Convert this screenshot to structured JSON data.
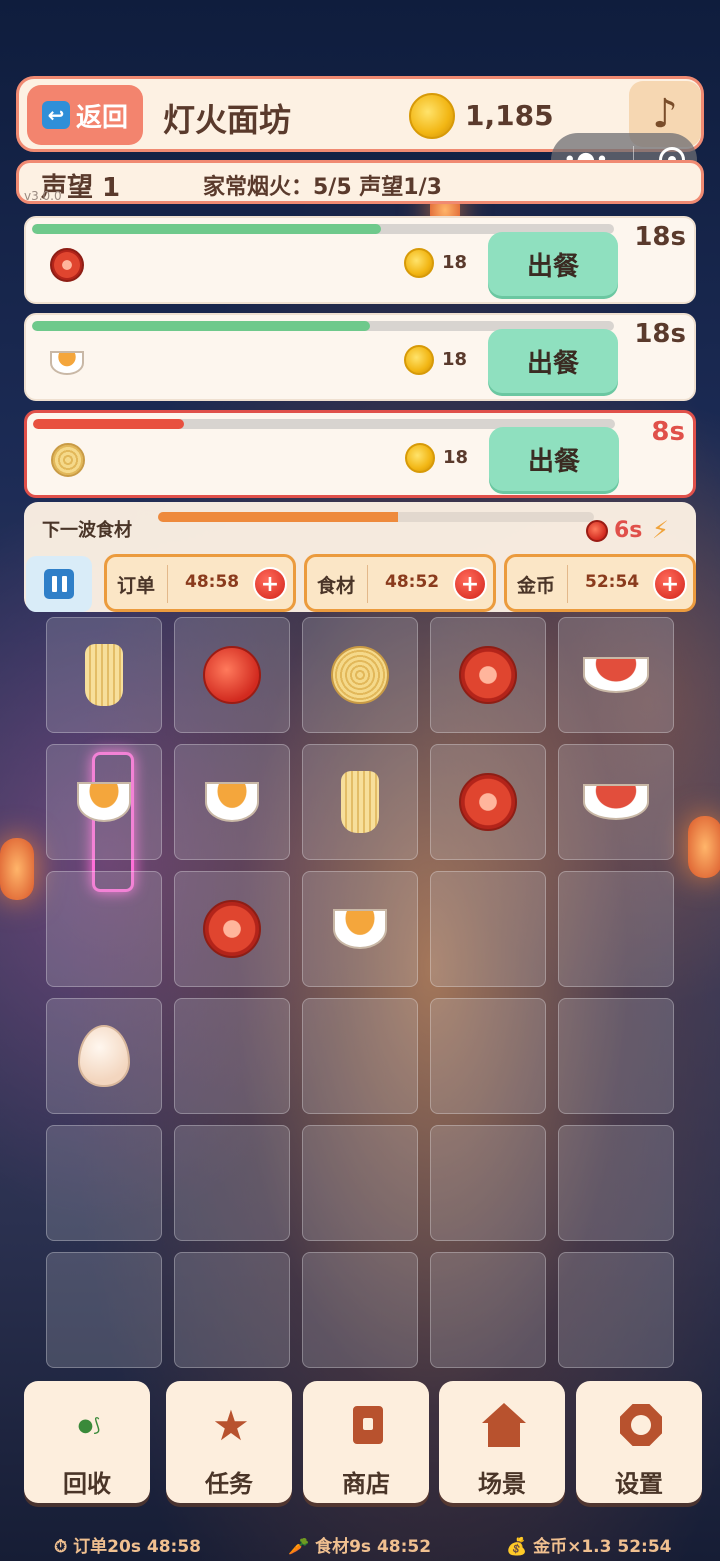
{
  "header": {
    "back_label": "返回",
    "back_icon": "↩",
    "shop_name": "灯火面坊",
    "coins": "1,185",
    "music_icon": "♪"
  },
  "reputation": {
    "level": "声望 1",
    "description": "家常烟火：5/5 声望1/3"
  },
  "version": "v3.0.0",
  "orders": [
    {
      "food": "tomato-slice",
      "progress": 0.6,
      "reward": "18",
      "serve_label": "出餐",
      "time": "18s",
      "urgent": false
    },
    {
      "food": "soup",
      "progress": 0.58,
      "reward": "18",
      "serve_label": "出餐",
      "time": "18s",
      "urgent": false
    },
    {
      "food": "noodles",
      "progress": 0.26,
      "reward": "18",
      "serve_label": "出餐",
      "time": "8s",
      "urgent": true
    }
  ],
  "wave": {
    "label": "下一波食材",
    "progress": 0.55,
    "time": "6s",
    "bolt": "⚡"
  },
  "boosts": [
    {
      "label": "订单",
      "time": "48:58",
      "plus": "+"
    },
    {
      "label": "食材",
      "time": "48:52",
      "plus": "+"
    },
    {
      "label": "金币",
      "time": "52:54",
      "plus": "+"
    }
  ],
  "board": [
    [
      "noodle-strands",
      "tomato",
      "noodles",
      "tomato-slice",
      "meat-bowl"
    ],
    [
      "soup",
      "soup",
      "noodle-strands",
      "tomato-slice",
      "meat-bowl"
    ],
    [
      "",
      "tomato-slice",
      "soup",
      "",
      ""
    ],
    [
      "egg",
      "",
      "",
      "",
      ""
    ],
    [
      "",
      "",
      "",
      "",
      ""
    ],
    [
      "",
      "",
      "",
      "",
      ""
    ]
  ],
  "nav": [
    {
      "label": "回收",
      "icon": "recycle-icon"
    },
    {
      "label": "任务",
      "icon": "star-icon"
    },
    {
      "label": "商店",
      "icon": "shop-icon"
    },
    {
      "label": "场景",
      "icon": "house-icon"
    },
    {
      "label": "设置",
      "icon": "gear-icon"
    }
  ],
  "status": {
    "orders": "⏱ 订单20s 48:58",
    "ingredients": "🥕 食材9s 48:52",
    "coins": "💰 金币×1.3 52:54"
  },
  "colors": {
    "accent": "#f3846e",
    "serve": "#8fe0bf",
    "urgent": "#e0504a",
    "progress_ok": "#6ec98b",
    "wave": "#ee8a3c"
  }
}
